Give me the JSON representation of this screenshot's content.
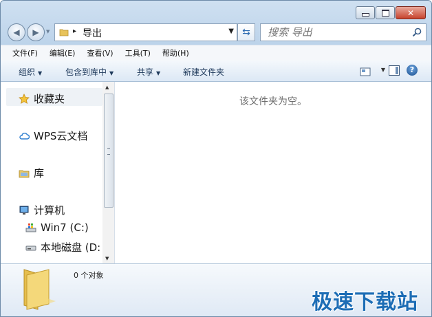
{
  "window": {
    "caption": {
      "minimize_symbol": "▭",
      "maximize_symbol": "□",
      "close_symbol": "✕"
    }
  },
  "nav": {
    "back_icon": "back-arrow-icon",
    "forward_icon": "forward-arrow-icon",
    "address": {
      "path": "导出",
      "separator": "▸"
    },
    "search": {
      "placeholder": "搜索 导出"
    }
  },
  "menu": {
    "items": [
      "文件(F)",
      "编辑(E)",
      "查看(V)",
      "工具(T)",
      "帮助(H)"
    ]
  },
  "toolbar": {
    "organize": "组织",
    "include_in_library": "包含到库中",
    "share": "共享",
    "new_folder": "新建文件夹",
    "help_symbol": "?"
  },
  "sidebar": {
    "items": [
      {
        "label": "收藏夹",
        "icon": "star-icon"
      },
      {
        "label": "WPS云文档",
        "icon": "cloud-icon"
      },
      {
        "label": "库",
        "icon": "library-icon"
      },
      {
        "label": "计算机",
        "icon": "computer-icon"
      },
      {
        "label": "Win7 (C:)",
        "icon": "drive-c-icon"
      },
      {
        "label": "本地磁盘 (D:",
        "icon": "drive-d-icon"
      }
    ]
  },
  "content": {
    "empty_message": "该文件夹为空。"
  },
  "details": {
    "item_count": "0 个对象"
  },
  "watermark": "极速下载站",
  "colors": {
    "accent": "#1d6db5",
    "frame": "#bcd3ea",
    "close_button": "#c7432d"
  }
}
